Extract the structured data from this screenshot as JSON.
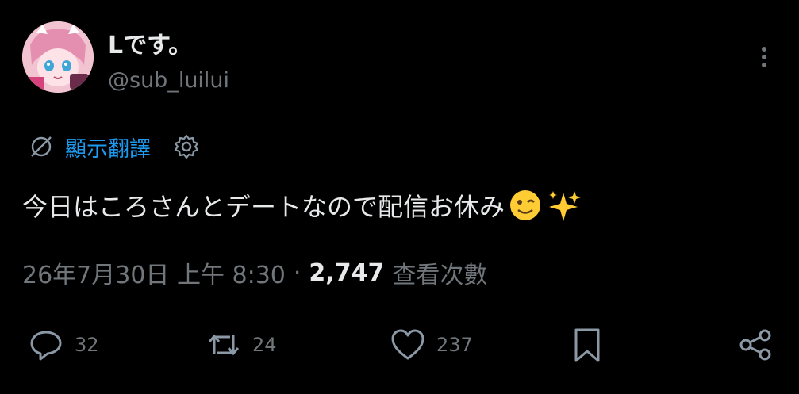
{
  "author": {
    "display_name": "Lです。",
    "handle": "@sub_luilui"
  },
  "translate": {
    "label": "顯示翻譯"
  },
  "tweet": {
    "text": "今日はころさんとデートなので配信お休み"
  },
  "meta": {
    "timestamp": "26年7月30日 上午 8:30",
    "separator": "·",
    "views_count": "2,747",
    "views_label": "查看次數"
  },
  "actions": {
    "replies": "32",
    "reposts": "24",
    "likes": "237"
  },
  "colors": {
    "background": "#000000",
    "text_primary": "#e7e9ea",
    "text_secondary": "#71767b",
    "accent_blue": "#1d9bf0"
  },
  "icons": {
    "translate": "translate-icon",
    "settings": "gear-icon",
    "more": "more-vertical-icon",
    "reply": "reply-icon",
    "repost": "repost-icon",
    "like": "heart-icon",
    "bookmark": "bookmark-icon",
    "share": "share-icon",
    "emoji_wink": "winking-face-emoji",
    "emoji_sparkles": "sparkles-emoji"
  }
}
